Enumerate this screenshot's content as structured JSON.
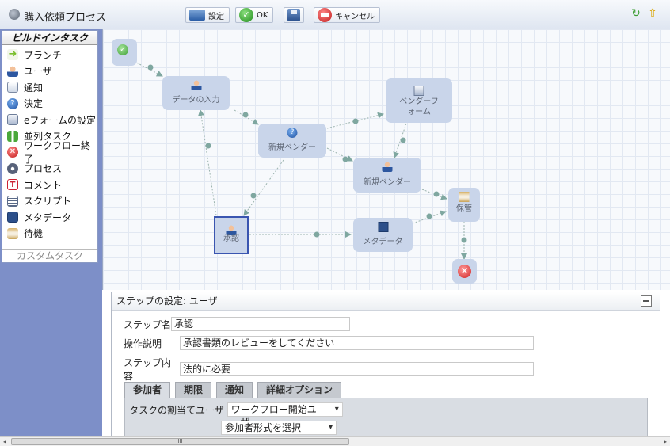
{
  "window": {
    "title": "購入依頼プロセス"
  },
  "toolbar": {
    "settings_label": "設定",
    "ok_label": "OK",
    "cancel_label": "キャンセル"
  },
  "builtin_tasks": {
    "header": "ビルドインタスク",
    "items": [
      {
        "label": "ブランチ",
        "icon": "arrow-right-icon"
      },
      {
        "label": "ユーザ",
        "icon": "user-icon"
      },
      {
        "label": "通知",
        "icon": "notification-icon"
      },
      {
        "label": "決定",
        "icon": "question-icon"
      },
      {
        "label": "eフォームの設定",
        "icon": "eform-icon"
      },
      {
        "label": "並列タスク",
        "icon": "parallel-icon"
      },
      {
        "label": "ワークフロー終了",
        "icon": "stop-icon"
      },
      {
        "label": "プロセス",
        "icon": "gear-icon"
      },
      {
        "label": "コメント",
        "icon": "comment-icon"
      },
      {
        "label": "スクリプト",
        "icon": "script-icon"
      },
      {
        "label": "メタデータ",
        "icon": "metadata-icon"
      },
      {
        "label": "待機",
        "icon": "hourglass-icon"
      }
    ],
    "custom_label": "カスタムタスク"
  },
  "workflow": {
    "nodes": {
      "data_input": "データの入力",
      "vendor_form": "ベンダーフォーム",
      "new_vendor_decision": "新規ベンダー",
      "new_vendor_user": "新規ベンダー",
      "approve": "承認",
      "metadata": "メタデータ",
      "save": "保管"
    }
  },
  "step_settings": {
    "title": "ステップの設定: ユーザ",
    "step_name_label": "ステップ名",
    "step_name_value": "承認",
    "description_label": "操作説明",
    "description_value": "承認書類のレビューをしてください",
    "content_label": "ステップ内容",
    "content_value": "法的に必要",
    "tabs": [
      "参加者",
      "期限",
      "通知",
      "詳細オプション"
    ],
    "assign_label": "タスクの割当てユーザ",
    "assign_value": "ワークフロー開始ユーザ",
    "participant_format_value": "参加者形式を選択"
  },
  "scrollbar": {
    "thumb_grip": "III"
  },
  "colors": {
    "accent": "#3a55b0",
    "panel_bg": "#7d8fc8",
    "node_bg": "#c9d5ea",
    "edge": "#7fa7a0"
  }
}
